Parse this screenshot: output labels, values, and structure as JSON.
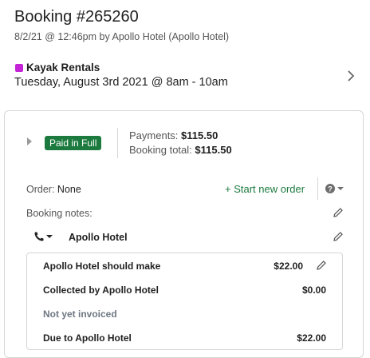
{
  "booking": {
    "title": "Booking #265260",
    "meta": "8/2/21 @ 12:46pm by Apollo Hotel (Apollo Hotel)"
  },
  "product": {
    "name": "Kayak Rentals",
    "time": "Tuesday, August 3rd 2021 @ 8am - 10am",
    "color": "#c424d6"
  },
  "payment": {
    "badge": "Paid in Full",
    "payments_label": "Payments:",
    "payments_value": "$115.50",
    "total_label": "Booking total:",
    "total_value": "$115.50"
  },
  "order": {
    "label": "Order:",
    "value": "None",
    "start_new": "+ Start new order"
  },
  "notes": {
    "label": "Booking notes:"
  },
  "agent": {
    "name": "Apollo Hotel"
  },
  "commission": {
    "rows": [
      {
        "label": "Apollo Hotel should make",
        "value": "$22.00"
      },
      {
        "label": "Collected by Apollo Hotel",
        "value": "$0.00"
      },
      {
        "label": "Not yet invoiced",
        "value": ""
      },
      {
        "label": "Due to Apollo Hotel",
        "value": "$22.00"
      }
    ]
  },
  "colors": {
    "accent_green": "#1c7a3e",
    "product_color": "#c424d6"
  },
  "icons": [
    "chevron-right-icon",
    "caret-right-icon",
    "help-icon",
    "caret-down-icon",
    "phone-icon",
    "pencil-icon"
  ]
}
